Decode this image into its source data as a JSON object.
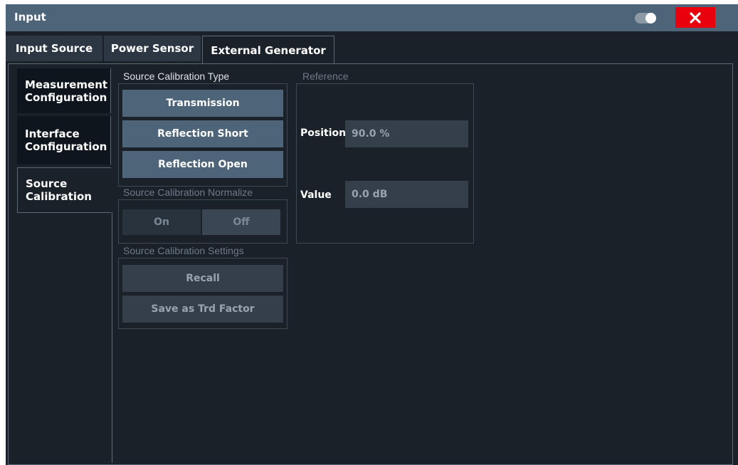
{
  "window": {
    "title": "Input",
    "close_icon": "close-icon",
    "toggle_icon": "toggle-icon"
  },
  "tabs": [
    {
      "label": "Input Source",
      "active": false
    },
    {
      "label": "Power Sensor",
      "active": false
    },
    {
      "label": "External Generator",
      "active": true
    }
  ],
  "side_tabs": [
    {
      "label": "Measurement Configuration",
      "lines": [
        "Measurement",
        "Configuration"
      ],
      "active": false
    },
    {
      "label": "Interface Configuration",
      "lines": [
        "Interface",
        "Configuration"
      ],
      "active": false
    },
    {
      "label": "Source Calibration",
      "lines": [
        "Source",
        "Calibration"
      ],
      "active": true
    }
  ],
  "calibration_type": {
    "label": "Source Calibration Type",
    "buttons": [
      "Transmission",
      "Reflection Short",
      "Reflection Open"
    ]
  },
  "normalize": {
    "label": "Source Calibration Normalize",
    "on_label": "On",
    "off_label": "Off",
    "selected": "Off",
    "enabled": false
  },
  "settings": {
    "label": "Source Calibration Settings",
    "buttons": [
      "Recall",
      "Save as Trd Factor"
    ],
    "enabled": false
  },
  "reference": {
    "label": "Reference",
    "position_label": "Position",
    "position_value": "90.0 %",
    "value_label": "Value",
    "value_value": "0.0 dB"
  },
  "colors": {
    "titlebar": "#4d6479",
    "close": "#e8000d",
    "button_active": "#4d6479",
    "button_disabled": "#343f4b",
    "background": "#1b2129"
  }
}
